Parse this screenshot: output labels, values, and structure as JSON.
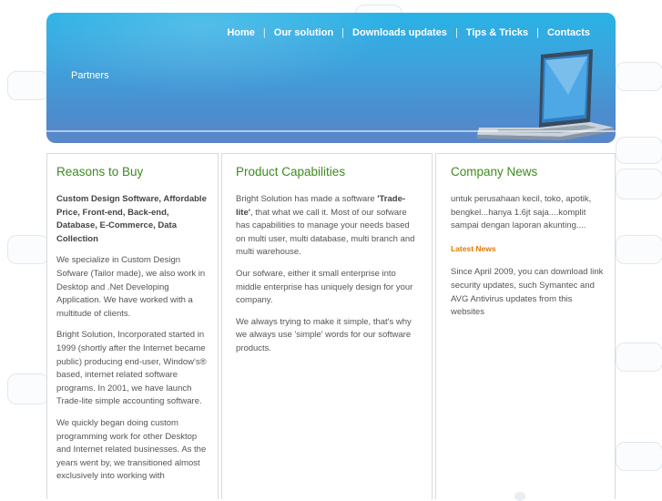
{
  "nav": {
    "items": [
      {
        "label": "Home"
      },
      {
        "label": "Our solution"
      },
      {
        "label": "Downloads updates"
      },
      {
        "label": "Tips & Tricks"
      },
      {
        "label": "Contacts"
      }
    ],
    "separator": "|"
  },
  "header": {
    "section_title": "Partners"
  },
  "columns": {
    "reasons": {
      "title": "Reasons to Buy",
      "lead": "Custom Design Software, Affordable Price, Front-end, Back-end, Database, E-Commerce, Data Collection",
      "p1": "We specialize in Custom Design Sofware (Tailor made), we also work in Desktop and .Net Developing Application. We have worked with a multitude of clients.",
      "p2": "Bright Solution, Incorporated started in 1999 (shortly after the Internet became public) producing end-user, Window's® based, internet related software programs. In 2001, we have launch Trade-lite simple accounting software.",
      "p3": "We quickly began doing custom programming work for other Desktop and Internet related businesses. As the years went by, we transitioned almost exclusively into working with"
    },
    "capabilities": {
      "title": "Product Capabilities",
      "p1_before": "Bright Solution has made a software ",
      "p1_bold": "'Trade-lite'",
      "p1_after": ", that what we call it. Most of our sofware has capabilities to manage your needs based on multi user, multi database, multi branch and multi warehouse.",
      "p2": "Our sofware, either it small enterprise into middle enterprise has uniquely design for your company.",
      "p3": "We always trying to make it simple, that's why we always use 'simple' words for our software products."
    },
    "news": {
      "title": "Company News",
      "p1": "untuk perusahaan kecil, toko, apotik, bengkel...hanya 1.6jt saja....komplit sampai dengan laporan akunting....",
      "latest_label": "Latest News",
      "p2": "Since April 2009, you can download link security updates, such Symantec and AVG Antivirus updates from this websites"
    }
  },
  "colors": {
    "header_top": "#29b3e6",
    "header_bottom": "#5a86c8",
    "heading_green": "#3e8b1f",
    "latest_news_orange": "#e07a00",
    "body_text": "#555555"
  }
}
